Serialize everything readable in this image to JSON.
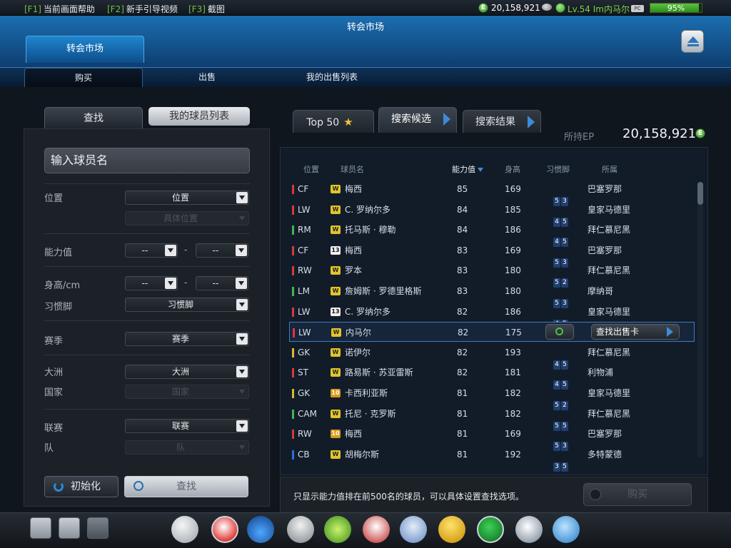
{
  "topbar": {
    "hotkeys": [
      {
        "key": "[F1]",
        "label": "当前画面帮助"
      },
      {
        "key": "[F2]",
        "label": "新手引导视频"
      },
      {
        "key": "[F3]",
        "label": "截图"
      }
    ],
    "ep_coin": "E",
    "ep": "20,158,921",
    "level_user": "Lv.54 Im内马尔",
    "pc_badge": "PC",
    "progress_percent": 95,
    "progress_text": "95%"
  },
  "window": {
    "title": "转会市场",
    "top_tab": "转会市场",
    "subtabs": [
      "购买",
      "出售",
      "我的出售列表"
    ]
  },
  "search_panel": {
    "tabs": [
      "查找",
      "我的球员列表"
    ],
    "name_placeholder": "输入球员名",
    "labels": {
      "position": "位置",
      "ability": "能力值",
      "height": "身高/cm",
      "foot": "习惯脚",
      "season": "赛季",
      "continent": "大洲",
      "country": "国家",
      "league": "联赛",
      "team": "队"
    },
    "dropdowns": {
      "position": "位置",
      "specific_position": "具体位置",
      "ability_min": "--",
      "ability_max": "--",
      "height_min": "--",
      "height_max": "--",
      "foot": "习惯脚",
      "season": "赛季",
      "continent": "大洲",
      "country": "国家",
      "league": "联赛",
      "team": "队"
    },
    "range_sep": "-",
    "reset_button": "初始化",
    "search_button": "查找"
  },
  "results": {
    "tabs": [
      "Top 50",
      "搜索候选",
      "搜索结果"
    ],
    "held_ep_label": "所持EP",
    "held_ep": "20,158,921",
    "columns": [
      "位置",
      "球员名",
      "能力值",
      "身高",
      "习惯脚",
      "所属"
    ],
    "rows": [
      {
        "pos": "CF",
        "posColor": "#d83a3a",
        "badge": "W",
        "badgeBg": "#e2c42a",
        "badgeFg": "#222",
        "name": "梅西",
        "ability": "85",
        "height": "169",
        "feet": [
          "5",
          "3"
        ],
        "club": "巴塞罗那"
      },
      {
        "pos": "LW",
        "posColor": "#d83a3a",
        "badge": "W",
        "badgeBg": "#e2c42a",
        "badgeFg": "#222",
        "name": "C. 罗纳尔多",
        "ability": "84",
        "height": "185",
        "feet": [
          "4",
          "5"
        ],
        "club": "皇家马德里"
      },
      {
        "pos": "RM",
        "posColor": "#3fb84a",
        "badge": "W",
        "badgeBg": "#e2c42a",
        "badgeFg": "#222",
        "name": "托马斯 · 穆勒",
        "ability": "84",
        "height": "186",
        "feet": [
          "4",
          "5"
        ],
        "club": "拜仁慕尼黑"
      },
      {
        "pos": "CF",
        "posColor": "#d83a3a",
        "badge": "13",
        "badgeBg": "#f0f0f0",
        "badgeFg": "#111",
        "name": "梅西",
        "ability": "83",
        "height": "169",
        "feet": [
          "5",
          "3"
        ],
        "club": "巴塞罗那"
      },
      {
        "pos": "RW",
        "posColor": "#d83a3a",
        "badge": "W",
        "badgeBg": "#e2c42a",
        "badgeFg": "#222",
        "name": "罗本",
        "ability": "83",
        "height": "180",
        "feet": [
          "5",
          "2"
        ],
        "club": "拜仁慕尼黑"
      },
      {
        "pos": "LM",
        "posColor": "#3fb84a",
        "badge": "W",
        "badgeBg": "#e2c42a",
        "badgeFg": "#222",
        "name": "詹姆斯 · 罗德里格斯",
        "ability": "83",
        "height": "180",
        "feet": [
          "5",
          "3"
        ],
        "club": "摩纳哥"
      },
      {
        "pos": "LW",
        "posColor": "#d83a3a",
        "badge": "13",
        "badgeBg": "#f0f0f0",
        "badgeFg": "#111",
        "name": "C. 罗纳尔多",
        "ability": "82",
        "height": "186",
        "feet": [
          "4",
          "5"
        ],
        "club": "皇家马德里"
      },
      {
        "pos": "LW",
        "posColor": "#d83a3a",
        "badge": "W",
        "badgeBg": "#e2c42a",
        "badgeFg": "#222",
        "name": "内马尔",
        "ability": "82",
        "height": "175",
        "feet": [],
        "club": "",
        "selected": true
      },
      {
        "pos": "GK",
        "posColor": "#e0b530",
        "badge": "W",
        "badgeBg": "#e2c42a",
        "badgeFg": "#222",
        "name": "诺伊尔",
        "ability": "82",
        "height": "193",
        "feet": [
          "4",
          "5"
        ],
        "club": "拜仁慕尼黑"
      },
      {
        "pos": "ST",
        "posColor": "#d83a3a",
        "badge": "W",
        "badgeBg": "#e2c42a",
        "badgeFg": "#222",
        "name": "路易斯 · 苏亚雷斯",
        "ability": "82",
        "height": "181",
        "feet": [
          "4",
          "5"
        ],
        "club": "利物浦"
      },
      {
        "pos": "GK",
        "posColor": "#e0b530",
        "badge": "10",
        "badgeBg": "#d89a1a",
        "badgeFg": "#fff",
        "name": "卡西利亚斯",
        "ability": "81",
        "height": "182",
        "feet": [
          "5",
          "2"
        ],
        "club": "皇家马德里"
      },
      {
        "pos": "CAM",
        "posColor": "#3fb84a",
        "badge": "W",
        "badgeBg": "#e2c42a",
        "badgeFg": "#222",
        "name": "托尼 · 克罗斯",
        "ability": "81",
        "height": "182",
        "feet": [
          "5",
          "5"
        ],
        "club": "拜仁慕尼黑"
      },
      {
        "pos": "RW",
        "posColor": "#d83a3a",
        "badge": "10",
        "badgeBg": "#d89a1a",
        "badgeFg": "#fff",
        "name": "梅西",
        "ability": "81",
        "height": "169",
        "feet": [
          "5",
          "3"
        ],
        "club": "巴塞罗那"
      },
      {
        "pos": "CB",
        "posColor": "#2f6fd6",
        "badge": "W",
        "badgeBg": "#e2c42a",
        "badgeFg": "#222",
        "name": "胡梅尔斯",
        "ability": "81",
        "height": "192",
        "feet": [
          "3",
          "5"
        ],
        "club": "多特蒙德"
      }
    ],
    "row_action": "查找出售卡",
    "hint": "只显示能力值排在前500名的球员，可以具体设置查找选项。",
    "buy_button": "购买"
  },
  "dock": {
    "left_buttons": [
      "profile-icon",
      "chat-icon",
      "mail-icon"
    ],
    "menu_icons": [
      "whistle-icon",
      "ball-icon",
      "boots-icon",
      "trophy-icon",
      "ranking-icon",
      "jersey-icon",
      "notebook-icon",
      "gold-shirt-icon",
      "club-icon",
      "card-pack-icon",
      "shop-cart-icon"
    ]
  }
}
